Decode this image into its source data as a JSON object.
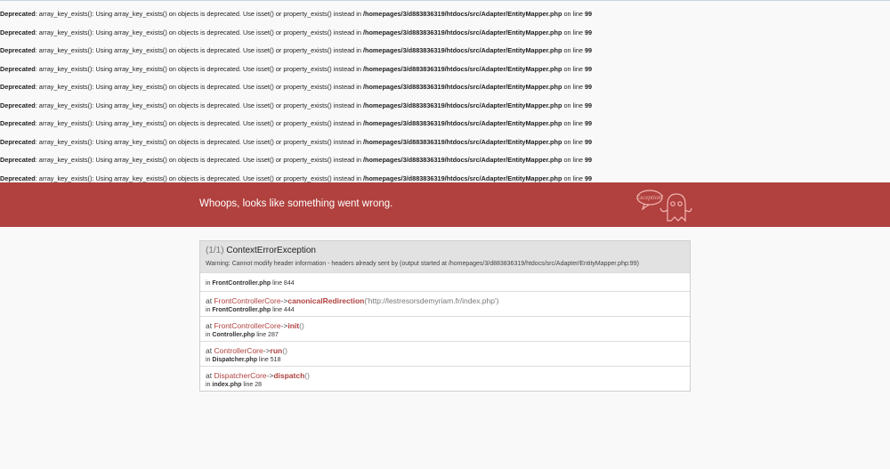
{
  "deprecations": [
    {
      "label": "Deprecated",
      "message": ": array_key_exists(): Using array_key_exists() on objects is deprecated. Use isset() or property_exists() instead in ",
      "file": "/homepages/3/d883836319/htdocs/src/Adapter/EntityMapper.php",
      "on_line": " on line ",
      "line": "99"
    },
    {
      "label": "Deprecated",
      "message": ": array_key_exists(): Using array_key_exists() on objects is deprecated. Use isset() or property_exists() instead in ",
      "file": "/homepages/3/d883836319/htdocs/src/Adapter/EntityMapper.php",
      "on_line": " on line ",
      "line": "99"
    },
    {
      "label": "Deprecated",
      "message": ": array_key_exists(): Using array_key_exists() on objects is deprecated. Use isset() or property_exists() instead in ",
      "file": "/homepages/3/d883836319/htdocs/src/Adapter/EntityMapper.php",
      "on_line": " on line ",
      "line": "99"
    },
    {
      "label": "Deprecated",
      "message": ": array_key_exists(): Using array_key_exists() on objects is deprecated. Use isset() or property_exists() instead in ",
      "file": "/homepages/3/d883836319/htdocs/src/Adapter/EntityMapper.php",
      "on_line": " on line ",
      "line": "99"
    },
    {
      "label": "Deprecated",
      "message": ": array_key_exists(): Using array_key_exists() on objects is deprecated. Use isset() or property_exists() instead in ",
      "file": "/homepages/3/d883836319/htdocs/src/Adapter/EntityMapper.php",
      "on_line": " on line ",
      "line": "99"
    },
    {
      "label": "Deprecated",
      "message": ": array_key_exists(): Using array_key_exists() on objects is deprecated. Use isset() or property_exists() instead in ",
      "file": "/homepages/3/d883836319/htdocs/src/Adapter/EntityMapper.php",
      "on_line": " on line ",
      "line": "99"
    },
    {
      "label": "Deprecated",
      "message": ": array_key_exists(): Using array_key_exists() on objects is deprecated. Use isset() or property_exists() instead in ",
      "file": "/homepages/3/d883836319/htdocs/src/Adapter/EntityMapper.php",
      "on_line": " on line ",
      "line": "99"
    },
    {
      "label": "Deprecated",
      "message": ": array_key_exists(): Using array_key_exists() on objects is deprecated. Use isset() or property_exists() instead in ",
      "file": "/homepages/3/d883836319/htdocs/src/Adapter/EntityMapper.php",
      "on_line": " on line ",
      "line": "99"
    },
    {
      "label": "Deprecated",
      "message": ": array_key_exists(): Using array_key_exists() on objects is deprecated. Use isset() or property_exists() instead in ",
      "file": "/homepages/3/d883836319/htdocs/src/Adapter/EntityMapper.php",
      "on_line": " on line ",
      "line": "99"
    },
    {
      "label": "Deprecated",
      "message": ": array_key_exists(): Using array_key_exists() on objects is deprecated. Use isset() or property_exists() instead in ",
      "file": "/homepages/3/d883836319/htdocs/src/Adapter/EntityMapper.php",
      "on_line": " on line ",
      "line": "99"
    }
  ],
  "header": {
    "title": "Whoops, looks like something went wrong.",
    "logo_icon": "ghost-mascot-icon",
    "logo_text": "Exception!",
    "brand_color": "#b0413e"
  },
  "exception": {
    "counter": "(1/1)",
    "class": "ContextErrorException",
    "message": "Warning: Cannot modify header information - headers already sent by (output started at /homepages/3/d883836319/htdocs/src/Adapter/EntityMapper.php:99)"
  },
  "trace": [
    {
      "class": "",
      "arrow": "",
      "fn": "",
      "args": "",
      "in": "in ",
      "file": "FrontController.php",
      "line_word": " line ",
      "line": "844"
    },
    {
      "at": "at ",
      "class": "FrontControllerCore",
      "arrow": "->",
      "fn": "canonicalRedirection",
      "args": "('http://lestresorsdemyriam.fr/index.php')",
      "in": "in ",
      "file": "FrontController.php",
      "line_word": " line ",
      "line": "444"
    },
    {
      "at": "at ",
      "class": "FrontControllerCore",
      "arrow": "->",
      "fn": "init",
      "args": "()",
      "in": "in ",
      "file": "Controller.php",
      "line_word": " line ",
      "line": "287"
    },
    {
      "at": "at ",
      "class": "ControllerCore",
      "arrow": "->",
      "fn": "run",
      "args": "()",
      "in": "in ",
      "file": "Dispatcher.php",
      "line_word": " line ",
      "line": "518"
    },
    {
      "at": "at ",
      "class": "DispatcherCore",
      "arrow": "->",
      "fn": "dispatch",
      "args": "()",
      "in": "in ",
      "file": "index.php",
      "line_word": " line ",
      "line": "28"
    }
  ]
}
